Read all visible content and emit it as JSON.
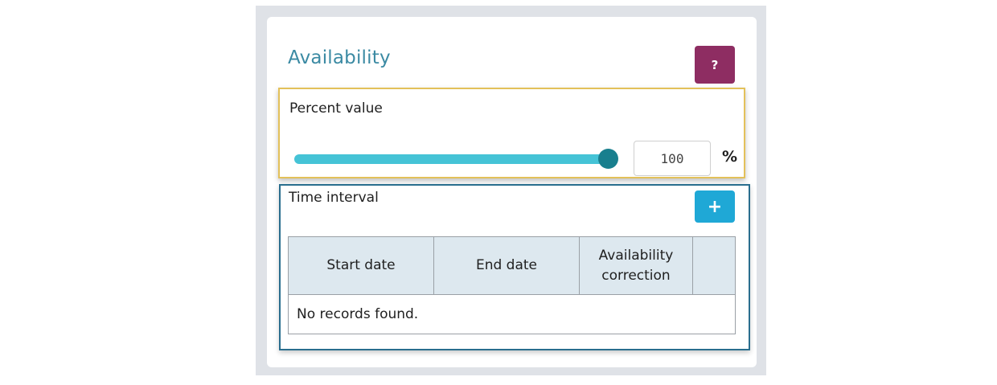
{
  "panel": {
    "title": "Availability",
    "help_label": "?"
  },
  "percent": {
    "label": "Percent value",
    "value": "100",
    "unit": "%",
    "slider_fraction": 1.0,
    "accent_color": "#45c3d6"
  },
  "time_interval": {
    "label": "Time interval",
    "add_label": "+",
    "columns": [
      "Start date",
      "End date",
      "Availability correction",
      ""
    ],
    "empty_message": "No records found."
  }
}
